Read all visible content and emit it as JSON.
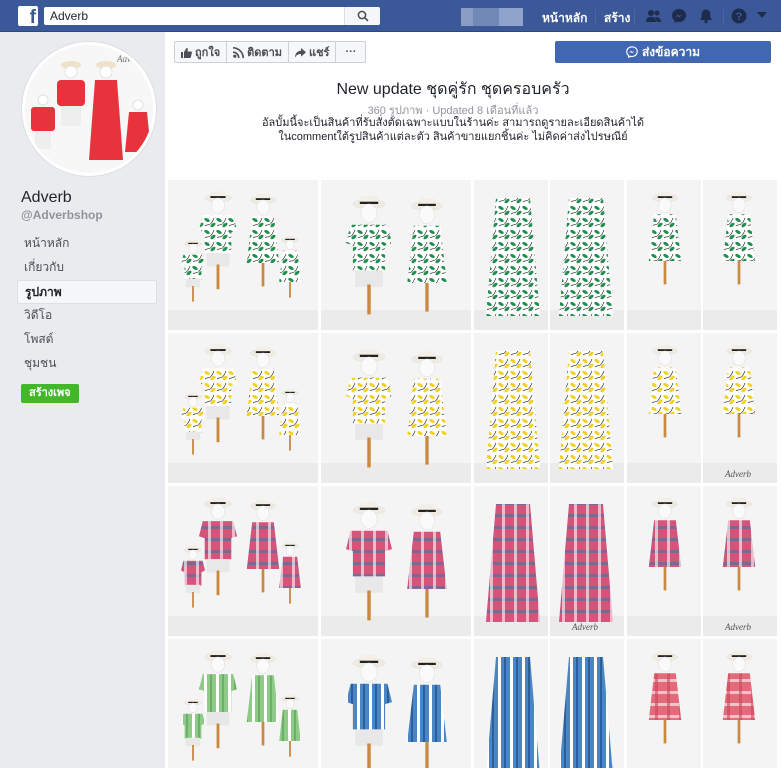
{
  "topbar": {
    "logo": "f",
    "search_value": "Adverb",
    "nav_home": "หน้าหลัก",
    "nav_create": "สร้าง"
  },
  "sidebar": {
    "page_name": "Adverb",
    "page_handle": "@Adverbshop",
    "items": [
      {
        "label": "หน้าหลัก"
      },
      {
        "label": "เกี่ยวกับ"
      },
      {
        "label": "รูปภาพ"
      },
      {
        "label": "วิดีโอ"
      },
      {
        "label": "โพสต์"
      },
      {
        "label": "ชุมชน"
      }
    ],
    "create_page": "สร้างเพจ"
  },
  "actions": {
    "like": "ถูกใจ",
    "follow": "ติดตาม",
    "share": "แชร์",
    "more": "···",
    "message": "ส่งข้อความ"
  },
  "album": {
    "title": "New update ชุดคู่รัก ชุดครอบครัว",
    "photo_count": "360 รูปภาพ",
    "separator": " · ",
    "updated": "Updated 8 เดือนที่แล้ว",
    "desc_line1": "อัลบั้มนี้จะเป็นสินค้าที่รับสั่งตัดเฉพาะแบบในร้านค่ะ สามารถดูรายละเอียดสินค้าได้",
    "desc_line2": "ในcommentใต้รูปสินค้าแต่ละตัว สินค้าขายแยกชิ้นค่ะ ไม่คิดค่าส่งไปรษณีย์"
  },
  "colors": {
    "brand": "#3b5998",
    "button_blue": "#4267b2",
    "create_green": "#42b72a"
  },
  "photos": [
    {
      "pattern": "green-floral",
      "caption": ""
    },
    {
      "pattern": "green-floral",
      "caption": ""
    },
    {
      "pattern": "green-floral",
      "caption": ""
    },
    {
      "pattern": "green-floral",
      "caption": ""
    },
    {
      "pattern": "yellow-floral",
      "caption": ""
    },
    {
      "pattern": "yellow-floral",
      "caption": ""
    },
    {
      "pattern": "yellow-floral",
      "caption": ""
    },
    {
      "pattern": "yellow-floral",
      "caption": "Adverb"
    },
    {
      "pattern": "red-plaid",
      "caption": ""
    },
    {
      "pattern": "red-plaid",
      "caption": ""
    },
    {
      "pattern": "red-plaid",
      "caption": "Adverb"
    },
    {
      "pattern": "red-plaid",
      "caption": "Adverb"
    },
    {
      "pattern": "green-stripe",
      "caption": ""
    },
    {
      "pattern": "blue-stripe",
      "caption": ""
    },
    {
      "pattern": "blue-stripe",
      "caption": ""
    },
    {
      "pattern": "red-check",
      "caption": ""
    }
  ]
}
